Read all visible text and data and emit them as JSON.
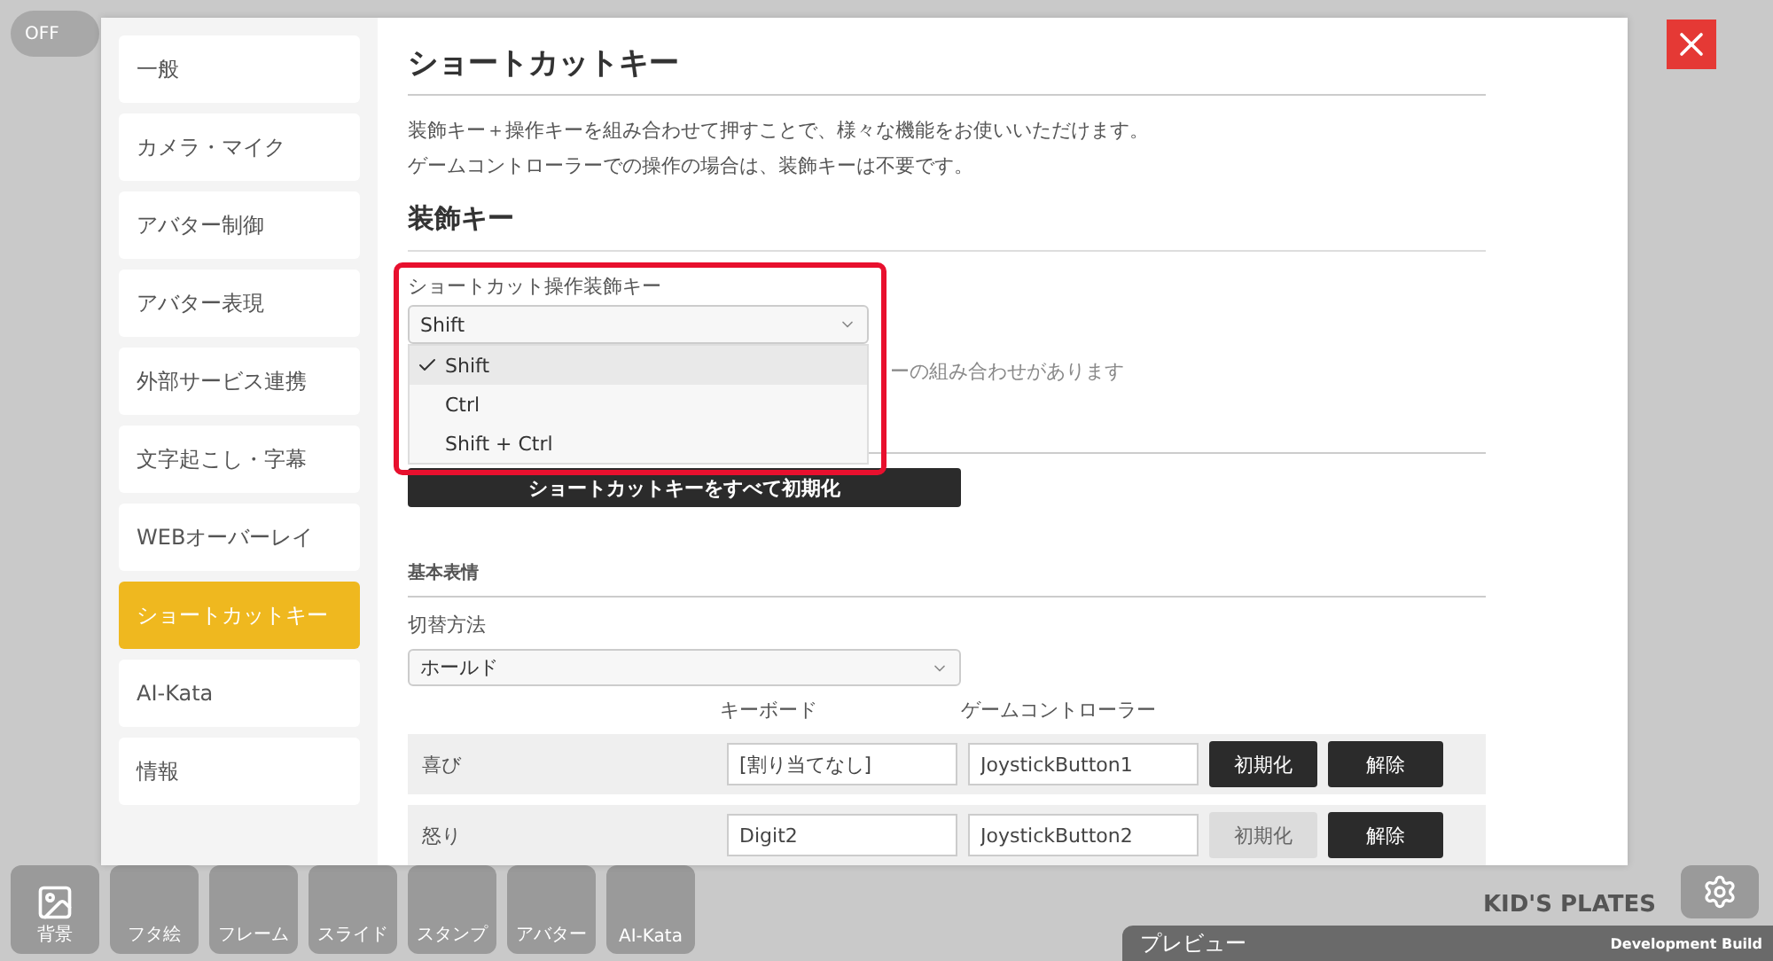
{
  "toggle": {
    "label": "OFF",
    "on": false
  },
  "sidebar": {
    "items": [
      {
        "label": "一般",
        "selected": false
      },
      {
        "label": "カメラ・マイク",
        "selected": false
      },
      {
        "label": "アバター制御",
        "selected": false
      },
      {
        "label": "アバター表現",
        "selected": false
      },
      {
        "label": "外部サービス連携",
        "selected": false
      },
      {
        "label": "文字起こし・字幕",
        "selected": false
      },
      {
        "label": "WEBオーバーレイ",
        "selected": false
      },
      {
        "label": "ショートカットキー",
        "selected": true
      },
      {
        "label": "AI-Kata",
        "selected": false
      },
      {
        "label": "情報",
        "selected": false
      }
    ]
  },
  "content": {
    "title": "ショートカットキー",
    "description": [
      "装飾キー＋操作キーを組み合わせて押すことで、様々な機能をお使いいただけます。",
      "ゲームコントローラーでの操作の場合は、装飾キーは不要です。"
    ],
    "modifier_section": {
      "heading": "装飾キー",
      "field_label": "ショートカット操作装飾キー",
      "value": "Shift",
      "options": [
        {
          "label": "Shift",
          "selected": true
        },
        {
          "label": "Ctrl",
          "selected": false
        },
        {
          "label": "Shift + Ctrl",
          "selected": false
        }
      ],
      "warning": "ーの組み合わせがあります"
    },
    "reset_all_button": "ショートカットキーをすべて初期化",
    "group": {
      "heading": "基本表情",
      "switch_label": "切替方法",
      "switch_value": "ホールド",
      "columns": [
        "キーボード",
        "ゲームコントローラー"
      ],
      "rows": [
        {
          "name": "喜び",
          "keyboard": "[割り当てなし]",
          "controller": "JoystickButton1",
          "reset": "初期化",
          "reset_disabled": false,
          "clear": "解除"
        },
        {
          "name": "怒り",
          "keyboard": "Digit2",
          "controller": "JoystickButton2",
          "reset": "初期化",
          "reset_disabled": true,
          "clear": "解除"
        }
      ]
    }
  },
  "toolbar": [
    "背景",
    "フタ絵",
    "フレーム",
    "スライド",
    "スタンプ",
    "アバター",
    "AI-Kata"
  ],
  "logo": "KID'S PLATES",
  "preview_bar": {
    "title": "プレビュー",
    "build": "Development Build"
  }
}
